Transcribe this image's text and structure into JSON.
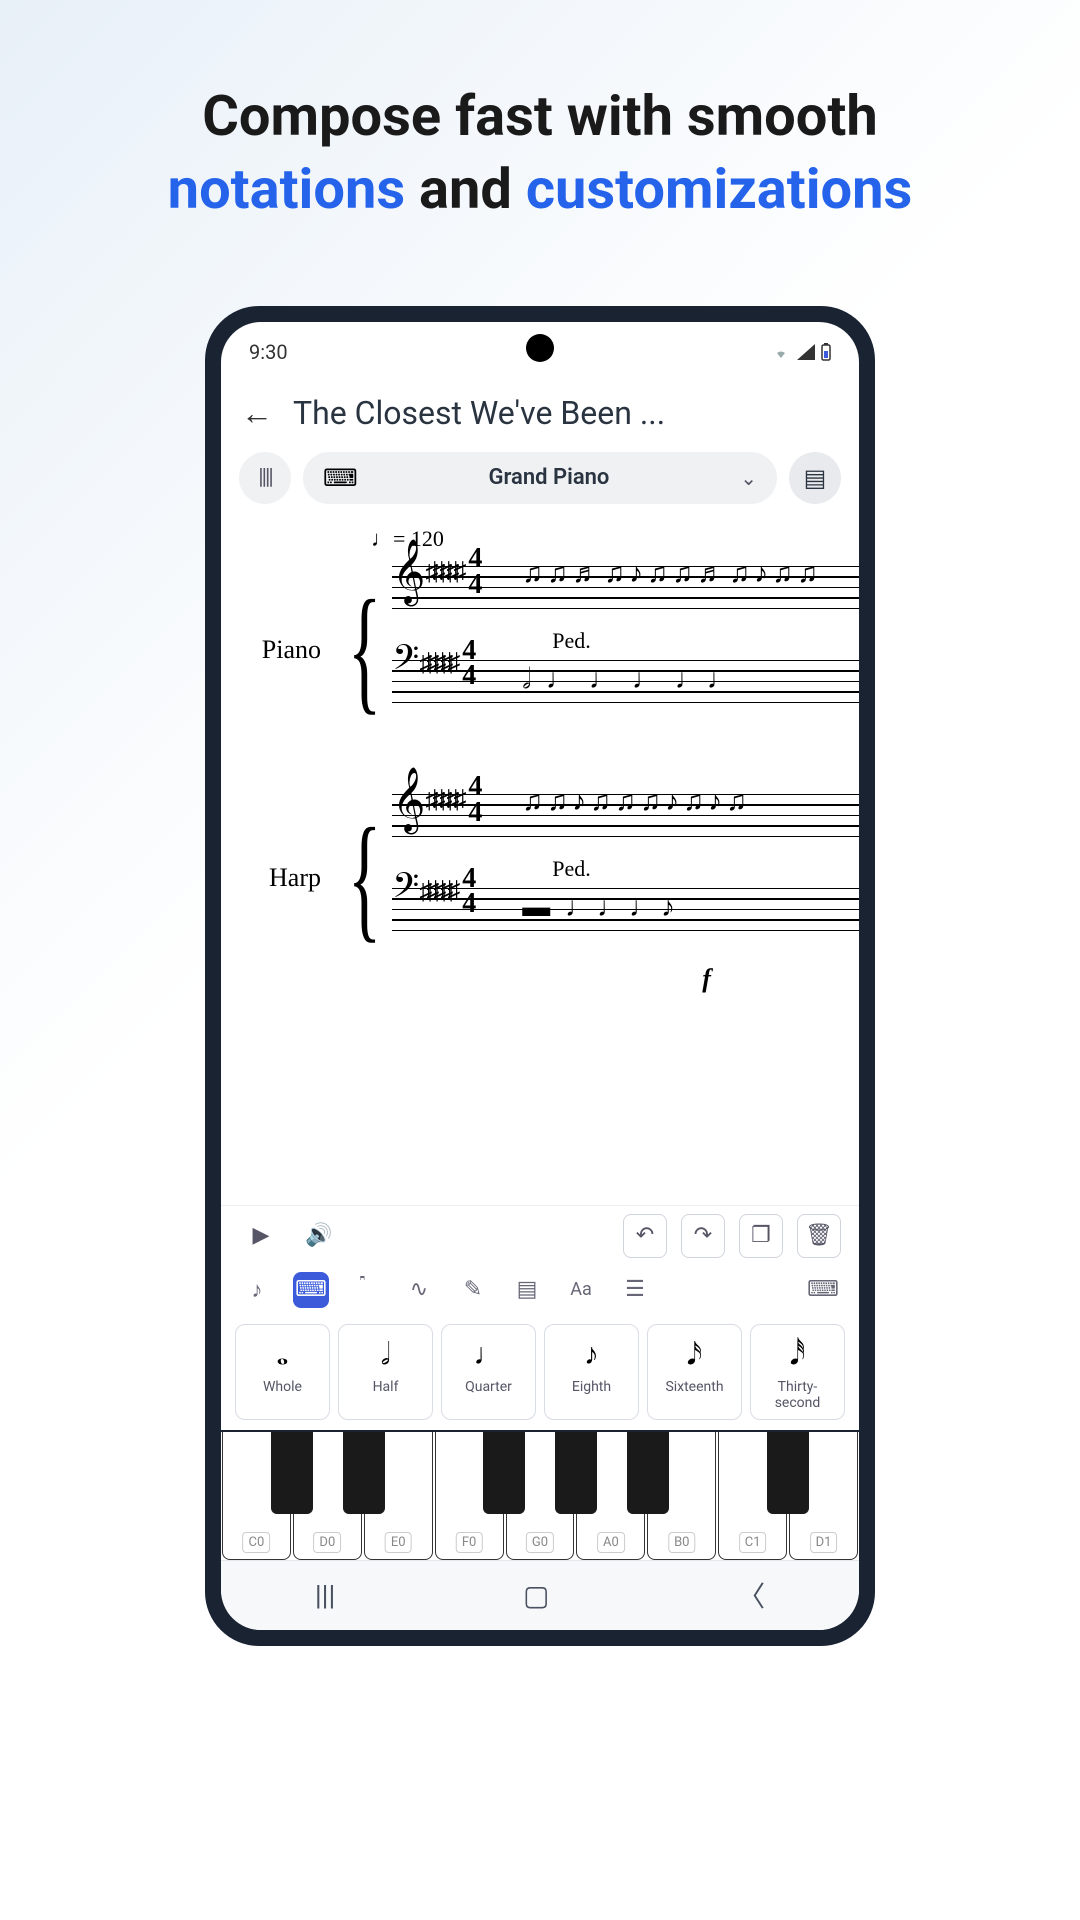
{
  "marketing": {
    "line1": "Compose fast with smooth",
    "word_notations": "notations",
    "word_and": " and ",
    "word_customizations": "customizations"
  },
  "status": {
    "time": "9:30"
  },
  "header": {
    "title": "The Closest We've Been ..."
  },
  "instrument": {
    "selected": "Grand Piano"
  },
  "score": {
    "tempo": "♩= 120",
    "instruments": [
      "Piano",
      "Harp"
    ],
    "pedal": "Ped.",
    "dynamic": "f",
    "timesig_top": "4",
    "timesig_bottom": "4"
  },
  "note_values": [
    {
      "glyph": "𝅝",
      "label": "Whole"
    },
    {
      "glyph": "𝅗𝅥",
      "label": "Half"
    },
    {
      "glyph": "♩",
      "label": "Quarter"
    },
    {
      "glyph": "♪",
      "label": "Eighth"
    },
    {
      "glyph": "𝅘𝅥𝅯",
      "label": "Sixteenth"
    },
    {
      "glyph": "𝅘𝅥𝅰",
      "label": "Thirty-second"
    }
  ],
  "keys": [
    "C0",
    "D0",
    "E0",
    "F0",
    "G0",
    "A0",
    "B0",
    "C1",
    "D1"
  ]
}
